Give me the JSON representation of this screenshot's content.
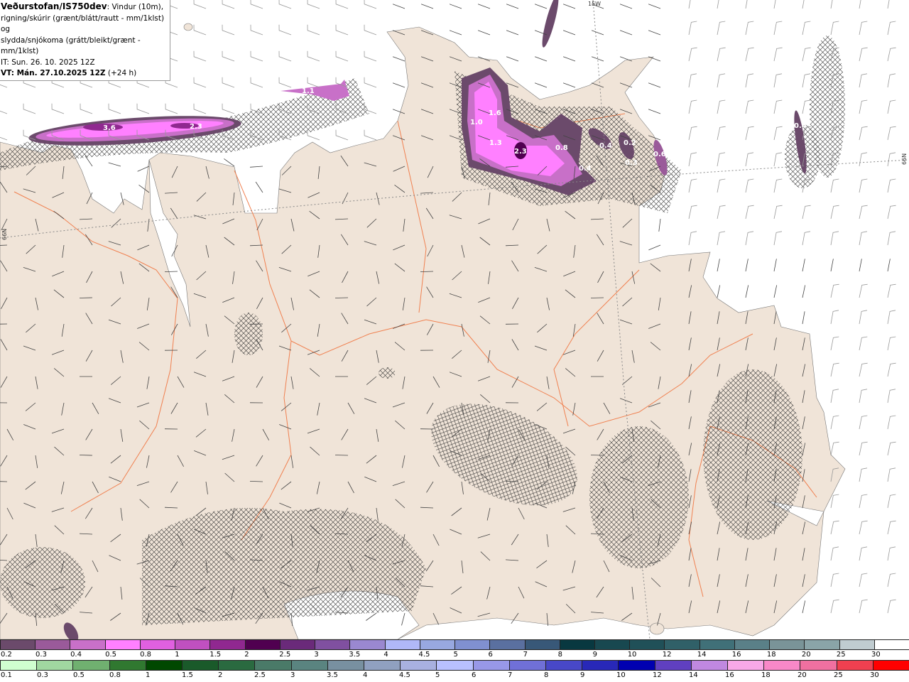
{
  "header": {
    "source": "Veðurstofan/IS750dev",
    "title_rest": ": Vindur (10m),",
    "line2": "rigning/skúrir (grænt/blátt/rautt - mm/1klst) og",
    "line3": "slydda/snjókoma (grátt/bleikt/grænt - mm/1klst)",
    "it": "IT: Sun. 26. 10. 2025 12Z",
    "vt_bold": "VT: Mán. 27.10.2025 12Z",
    "vt_rest": " (+24 h)"
  },
  "map": {
    "labels": {
      "lon": "15W",
      "lat_right": "66N",
      "lat_left": "66N"
    },
    "precip_labels": [
      "3.6",
      "2.3",
      "1.1",
      "1.6",
      "1.0",
      "1.3",
      "2.3",
      "0.8",
      "0.4",
      "0.4",
      "0.2",
      "0.3",
      "0.6",
      "0.4"
    ],
    "land_color": "#f0e4d8",
    "road_color": "#f08050"
  },
  "colorbar_snow": {
    "labels": [
      "0.2",
      "0.3",
      "0.4",
      "0.5",
      "0.8",
      "1",
      "1.5",
      "2",
      "2.5",
      "3",
      "3.5",
      "4",
      "4.5",
      "5",
      "6",
      "7",
      "8",
      "9",
      "10",
      "12",
      "14",
      "16",
      "18",
      "20",
      "25",
      "30"
    ],
    "colors": [
      "#6b4a6b",
      "#9a5a9a",
      "#c870c8",
      "#ff80ff",
      "#e060e0",
      "#c050c0",
      "#902890",
      "#500050",
      "#6a2a7a",
      "#8050a0",
      "#9a88d0",
      "#b0b8f8",
      "#98a8e0",
      "#8090d0",
      "#5a70a0",
      "#385878",
      "#083840",
      "#184850",
      "#205058",
      "#306068",
      "#407078",
      "#5a8088",
      "#7a9498",
      "#8aa4a8",
      "#c0ccd0",
      "#ffffff"
    ]
  },
  "colorbar_rain": {
    "labels": [
      "0.1",
      "0.3",
      "0.5",
      "0.8",
      "1",
      "1.5",
      "2",
      "2.5",
      "3",
      "3.5",
      "4",
      "4.5",
      "5",
      "6",
      "7",
      "8",
      "9",
      "10",
      "12",
      "14",
      "16",
      "18",
      "20",
      "25",
      "30"
    ],
    "colors": [
      "#d0ffd0",
      "#a0d8a0",
      "#70b070",
      "#307830",
      "#004800",
      "#1a5a2a",
      "#2a6a40",
      "#4a7a68",
      "#5a8480",
      "#7890a0",
      "#90a0c0",
      "#a8b0e0",
      "#b8c0ff",
      "#9898e8",
      "#7070d8",
      "#4848c8",
      "#2828b8",
      "#0000b0",
      "#6040c0",
      "#c088e0",
      "#f8a8e8",
      "#f888c8",
      "#f070a0",
      "#f04050",
      "#ff0000"
    ]
  }
}
